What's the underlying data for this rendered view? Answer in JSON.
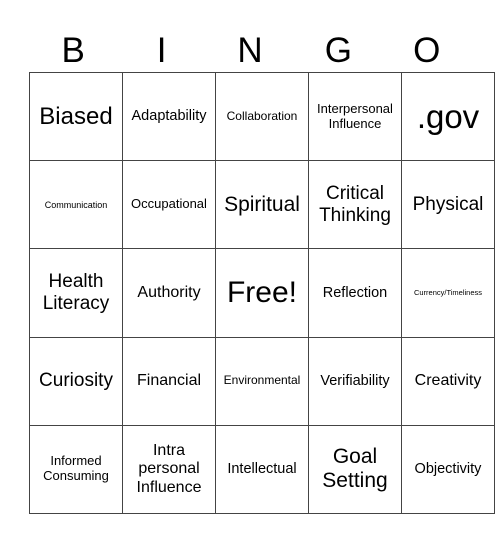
{
  "header": [
    "B",
    "I",
    "N",
    "G",
    "O"
  ],
  "cells": [
    [
      "Biased",
      "Adaptability",
      "Collaboration",
      "Interpersonal Influence",
      ".gov"
    ],
    [
      "Communication",
      "Occupational",
      "Spiritual",
      "Critical Thinking",
      "Physical"
    ],
    [
      "Health Literacy",
      "Authority",
      "Free!",
      "Reflection",
      "Currency/Timeliness"
    ],
    [
      "Curiosity",
      "Financial",
      "Environmental",
      "Verifiability",
      "Creativity"
    ],
    [
      "Informed Consuming",
      "Intra personal Influence",
      "Intellectual",
      "Goal Setting",
      "Objectivity"
    ]
  ]
}
